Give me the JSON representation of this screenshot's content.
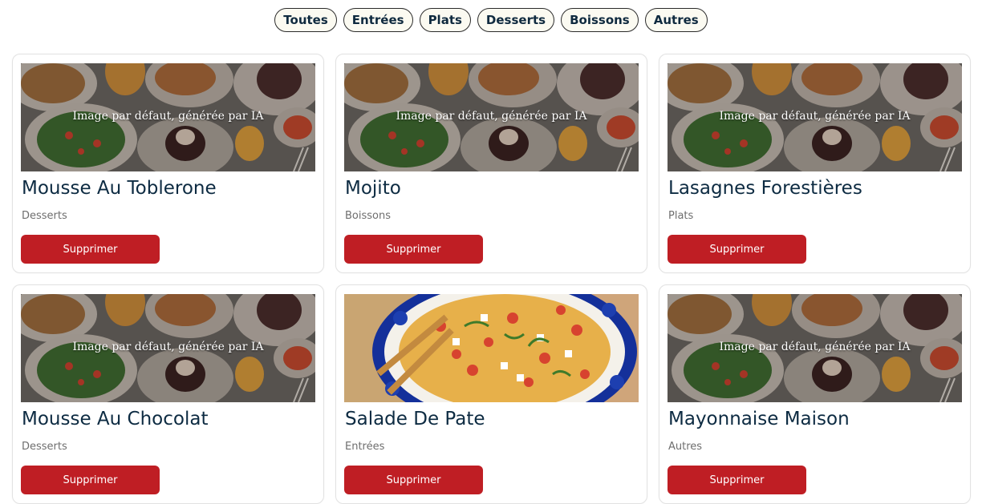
{
  "filters": [
    "Toutes",
    "Entrées",
    "Plats",
    "Desserts",
    "Boissons",
    "Autres"
  ],
  "default_image_caption": "Image par défaut, générée par IA",
  "delete_label": "Supprimer",
  "recipes": [
    {
      "title": "Mousse Au Toblerone",
      "category": "Desserts",
      "image": "default"
    },
    {
      "title": "Mojito",
      "category": "Boissons",
      "image": "default"
    },
    {
      "title": "Lasagnes Forestières",
      "category": "Plats",
      "image": "default"
    },
    {
      "title": "Mousse Au Chocolat",
      "category": "Desserts",
      "image": "default"
    },
    {
      "title": "Salade De Pate",
      "category": "Entrées",
      "image": "pasta-salad-photo"
    },
    {
      "title": "Mayonnaise Maison",
      "category": "Autres",
      "image": "default"
    }
  ],
  "colors": {
    "delete_button": "#bf1e24",
    "title_text": "#0d2b42",
    "chip_background": "#fbfaf1"
  }
}
